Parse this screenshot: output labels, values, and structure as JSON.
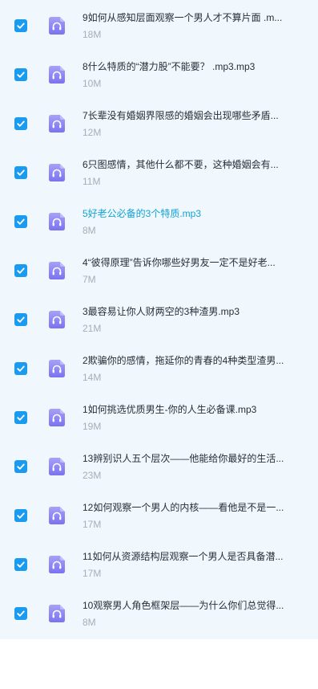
{
  "files": [
    {
      "name": "9如何从感知层面观察一个男人才不算片面 .m...",
      "size": "18M",
      "checked": true,
      "active": false,
      "icon": "headphones-icon"
    },
    {
      "name": "8什么特质的“潜力股”不能要？ .mp3.mp3",
      "size": "10M",
      "checked": true,
      "active": false,
      "icon": "headphones-icon"
    },
    {
      "name": "7长辈没有婚姻界限感的婚姻会出现哪些矛盾...",
      "size": "12M",
      "checked": true,
      "active": false,
      "icon": "headphones-icon"
    },
    {
      "name": "6只图感情，其他什么都不要，这种婚姻会有...",
      "size": "11M",
      "checked": true,
      "active": false,
      "icon": "headphones-icon"
    },
    {
      "name": "5好老公必备的3个特质.mp3",
      "size": "8M",
      "checked": true,
      "active": true,
      "icon": "headphones-icon"
    },
    {
      "name": "4“彼得原理”告诉你哪些好男友一定不是好老...",
      "size": "7M",
      "checked": true,
      "active": false,
      "icon": "headphones-icon"
    },
    {
      "name": "3最容易让你人财两空的3种渣男.mp3",
      "size": "21M",
      "checked": true,
      "active": false,
      "icon": "headphones-icon"
    },
    {
      "name": "2欺骗你的感情，拖延你的青春的4种类型渣男...",
      "size": "14M",
      "checked": true,
      "active": false,
      "icon": "headphones-icon"
    },
    {
      "name": "1如何挑选优质男生-你的人生必备课.mp3",
      "size": "19M",
      "checked": true,
      "active": false,
      "icon": "headphones-icon"
    },
    {
      "name": "13辨别识人五个层次——他能给你最好的生活...",
      "size": "23M",
      "checked": true,
      "active": false,
      "icon": "headphones-icon"
    },
    {
      "name": "12如何观察一个男人的内核——看他是不是一...",
      "size": "17M",
      "checked": true,
      "active": false,
      "icon": "headphones-icon"
    },
    {
      "name": "11如何从资源结构层观察一个男人是否具备潜...",
      "size": "17M",
      "checked": true,
      "active": false,
      "icon": "headphones-icon"
    },
    {
      "name": "10观察男人角色框架层——为什么你们总觉得...",
      "size": "8M",
      "checked": true,
      "active": false,
      "icon": "headphones-icon"
    }
  ],
  "colors": {
    "checkbox": "#1a9bf0",
    "icon_gradient_top": "#a7a1f7",
    "icon_gradient_bottom": "#7b72ef",
    "active_text": "#12a3d6",
    "list_background": "#f0f7fd"
  }
}
